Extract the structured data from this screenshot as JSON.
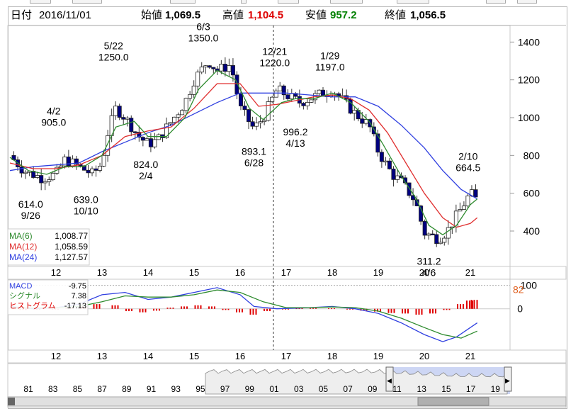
{
  "header": {
    "date_label": "日付",
    "date_value": "2016/11/01",
    "open_label": "始値",
    "open_value": "1,069.5",
    "high_label": "高値",
    "high_value": "1,104.5",
    "low_label": "安値",
    "low_value": "957.2",
    "close_label": "終値",
    "close_value": "1,056.5"
  },
  "colors": {
    "up": "#ffffff",
    "down": "#000080",
    "ma6": "#2e8b2e",
    "ma12": "#e03030",
    "ma24": "#3040e0",
    "high_text": "#dd0000",
    "low_text": "#008000",
    "histogram": "#e00000",
    "macd": "#3040e0",
    "signal": "#2e8b2e",
    "navigator_fill": "#b8c4f0"
  },
  "legend": {
    "ma6_label": "MA(6)",
    "ma6_value": "1,008.77",
    "ma12_label": "MA(12)",
    "ma12_value": "1,058.59",
    "ma24_label": "MA(24)",
    "ma24_value": "1,127.57",
    "macd_label": "MACD",
    "macd_value": "-9.75",
    "signal_label": "シグナル",
    "signal_value": "7.38",
    "hist_label": "ヒストグラム",
    "hist_value": "-17.13"
  },
  "chart_data": {
    "type": "candlestick",
    "price_axis": {
      "ticks": [
        "1400",
        "1200",
        "1000",
        "800",
        "600",
        "400"
      ],
      "range": [
        220,
        1480
      ],
      "position": "right"
    },
    "x_labels": [
      "12",
      "13",
      "14",
      "15",
      "16",
      "17",
      "18",
      "19",
      "20",
      "21"
    ],
    "annotations": [
      {
        "date": "9/26",
        "value": "614.0",
        "kind": "low"
      },
      {
        "date": "4/2",
        "value": "905.0",
        "kind": "high"
      },
      {
        "date": "10/10",
        "value": "639.0",
        "kind": "low"
      },
      {
        "date": "5/22",
        "value": "1250.0",
        "kind": "high"
      },
      {
        "date": "2/4",
        "value": "824.0",
        "kind": "low"
      },
      {
        "date": "6/3",
        "value": "1350.0",
        "kind": "high"
      },
      {
        "date": "6/28",
        "value": "893.1",
        "kind": "low"
      },
      {
        "date": "12/21",
        "value": "1220.0",
        "kind": "high"
      },
      {
        "date": "4/13",
        "value": "996.2",
        "kind": "low"
      },
      {
        "date": "1/29",
        "value": "1197.0",
        "kind": "high"
      },
      {
        "date": "4/6",
        "value": "311.2",
        "kind": "low"
      },
      {
        "date": "2/10",
        "value": "664.5",
        "kind": "high"
      }
    ],
    "series_close_path": [
      [
        11.0,
        800
      ],
      [
        11.3,
        720
      ],
      [
        11.7,
        680
      ],
      [
        12.0,
        700
      ],
      [
        12.2,
        780
      ],
      [
        12.5,
        740
      ],
      [
        12.8,
        700
      ],
      [
        13.0,
        760
      ],
      [
        13.1,
        900
      ],
      [
        13.3,
        1050
      ],
      [
        13.5,
        1000
      ],
      [
        13.8,
        900
      ],
      [
        14.0,
        860
      ],
      [
        14.2,
        880
      ],
      [
        14.5,
        980
      ],
      [
        14.8,
        1080
      ],
      [
        15.0,
        1200
      ],
      [
        15.3,
        1300
      ],
      [
        15.5,
        1250
      ],
      [
        15.8,
        1280
      ],
      [
        16.0,
        1050
      ],
      [
        16.3,
        940
      ],
      [
        16.5,
        1000
      ],
      [
        16.8,
        1150
      ],
      [
        17.0,
        1120
      ],
      [
        17.3,
        1080
      ],
      [
        17.5,
        1100
      ],
      [
        17.8,
        1130
      ],
      [
        18.0,
        1150
      ],
      [
        18.2,
        1100
      ],
      [
        18.5,
        1020
      ],
      [
        18.8,
        960
      ],
      [
        19.0,
        820
      ],
      [
        19.3,
        700
      ],
      [
        19.5,
        660
      ],
      [
        19.8,
        560
      ],
      [
        20.0,
        390
      ],
      [
        20.3,
        360
      ],
      [
        20.5,
        400
      ],
      [
        20.8,
        520
      ],
      [
        21.0,
        600
      ],
      [
        21.15,
        560
      ]
    ],
    "ma6_path": [
      [
        11.0,
        790
      ],
      [
        11.4,
        720
      ],
      [
        11.8,
        700
      ],
      [
        12.2,
        740
      ],
      [
        12.6,
        740
      ],
      [
        13.0,
        800
      ],
      [
        13.3,
        950
      ],
      [
        13.7,
        980
      ],
      [
        14.0,
        900
      ],
      [
        14.4,
        900
      ],
      [
        14.8,
        1000
      ],
      [
        15.1,
        1150
      ],
      [
        15.5,
        1250
      ],
      [
        15.9,
        1200
      ],
      [
        16.2,
        1050
      ],
      [
        16.5,
        990
      ],
      [
        16.9,
        1080
      ],
      [
        17.2,
        1100
      ],
      [
        17.6,
        1100
      ],
      [
        18.0,
        1130
      ],
      [
        18.4,
        1080
      ],
      [
        18.8,
        980
      ],
      [
        19.1,
        860
      ],
      [
        19.5,
        690
      ],
      [
        19.8,
        580
      ],
      [
        20.1,
        430
      ],
      [
        20.4,
        380
      ],
      [
        20.7,
        430
      ],
      [
        21.0,
        540
      ],
      [
        21.15,
        570
      ]
    ],
    "ma12_path": [
      [
        11.0,
        760
      ],
      [
        11.5,
        730
      ],
      [
        12.0,
        730
      ],
      [
        12.5,
        750
      ],
      [
        13.0,
        800
      ],
      [
        13.5,
        900
      ],
      [
        14.0,
        930
      ],
      [
        14.5,
        950
      ],
      [
        15.0,
        1050
      ],
      [
        15.5,
        1180
      ],
      [
        16.0,
        1180
      ],
      [
        16.4,
        1060
      ],
      [
        16.8,
        1070
      ],
      [
        17.2,
        1090
      ],
      [
        17.6,
        1110
      ],
      [
        18.0,
        1120
      ],
      [
        18.4,
        1100
      ],
      [
        18.8,
        1040
      ],
      [
        19.2,
        920
      ],
      [
        19.6,
        760
      ],
      [
        20.0,
        600
      ],
      [
        20.4,
        470
      ],
      [
        20.7,
        420
      ],
      [
        21.0,
        440
      ],
      [
        21.15,
        470
      ]
    ],
    "ma24_path": [
      [
        11.0,
        720
      ],
      [
        11.5,
        740
      ],
      [
        12.0,
        750
      ],
      [
        12.5,
        760
      ],
      [
        13.0,
        820
      ],
      [
        13.5,
        870
      ],
      [
        14.0,
        920
      ],
      [
        14.5,
        960
      ],
      [
        15.0,
        1020
      ],
      [
        15.5,
        1080
      ],
      [
        16.0,
        1130
      ],
      [
        16.5,
        1130
      ],
      [
        17.0,
        1130
      ],
      [
        17.5,
        1120
      ],
      [
        18.0,
        1110
      ],
      [
        18.5,
        1110
      ],
      [
        19.0,
        1060
      ],
      [
        19.5,
        960
      ],
      [
        20.0,
        840
      ],
      [
        20.4,
        720
      ],
      [
        20.8,
        620
      ],
      [
        21.15,
        570
      ]
    ],
    "macd_axis": {
      "ticks": [
        "100",
        "0"
      ],
      "marker_value": "82"
    },
    "macd_path": [
      [
        11.0,
        10
      ],
      [
        11.5,
        0
      ],
      [
        12.0,
        5
      ],
      [
        12.5,
        20
      ],
      [
        13.0,
        60
      ],
      [
        13.5,
        70
      ],
      [
        14.0,
        40
      ],
      [
        14.5,
        50
      ],
      [
        15.0,
        70
      ],
      [
        15.5,
        90
      ],
      [
        16.0,
        60
      ],
      [
        16.3,
        10
      ],
      [
        16.8,
        0
      ],
      [
        17.5,
        5
      ],
      [
        18.0,
        10
      ],
      [
        18.5,
        0
      ],
      [
        19.0,
        -20
      ],
      [
        19.5,
        -60
      ],
      [
        20.0,
        -110
      ],
      [
        20.4,
        -140
      ],
      [
        20.7,
        -120
      ],
      [
        21.15,
        -60
      ]
    ],
    "signal_path": [
      [
        11.0,
        5
      ],
      [
        11.5,
        3
      ],
      [
        12.0,
        5
      ],
      [
        12.5,
        10
      ],
      [
        13.0,
        30
      ],
      [
        13.5,
        55
      ],
      [
        14.0,
        50
      ],
      [
        14.5,
        50
      ],
      [
        15.0,
        60
      ],
      [
        15.5,
        80
      ],
      [
        16.0,
        70
      ],
      [
        16.5,
        30
      ],
      [
        17.0,
        5
      ],
      [
        17.5,
        5
      ],
      [
        18.0,
        8
      ],
      [
        18.5,
        5
      ],
      [
        19.0,
        -10
      ],
      [
        19.5,
        -40
      ],
      [
        20.0,
        -80
      ],
      [
        20.4,
        -110
      ],
      [
        20.8,
        -125
      ],
      [
        21.15,
        -95
      ]
    ],
    "histogram_values": [
      [
        11.3,
        -5
      ],
      [
        11.6,
        -4
      ],
      [
        12.0,
        -3
      ],
      [
        12.3,
        5
      ],
      [
        12.6,
        10
      ],
      [
        12.9,
        20
      ],
      [
        13.3,
        15
      ],
      [
        13.6,
        -10
      ],
      [
        13.9,
        -15
      ],
      [
        14.2,
        -8
      ],
      [
        14.5,
        5
      ],
      [
        14.8,
        10
      ],
      [
        15.1,
        15
      ],
      [
        15.4,
        10
      ],
      [
        15.7,
        -5
      ],
      [
        16.0,
        -15
      ],
      [
        16.3,
        -25
      ],
      [
        16.6,
        -10
      ],
      [
        17.0,
        -2
      ],
      [
        17.3,
        2
      ],
      [
        17.6,
        3
      ],
      [
        18.0,
        2
      ],
      [
        18.4,
        -3
      ],
      [
        18.7,
        -8
      ],
      [
        19.0,
        -12
      ],
      [
        19.3,
        -18
      ],
      [
        19.6,
        -20
      ],
      [
        19.9,
        -25
      ],
      [
        20.2,
        -20
      ],
      [
        20.5,
        -5
      ],
      [
        20.8,
        20
      ],
      [
        21.0,
        35
      ],
      [
        21.1,
        38
      ]
    ],
    "navigator_labels": [
      "81",
      "83",
      "85",
      "87",
      "89",
      "91",
      "93",
      "95",
      "97",
      "99",
      "01",
      "03",
      "05",
      "07",
      "09",
      "11",
      "13",
      "15",
      "17",
      "19"
    ]
  }
}
